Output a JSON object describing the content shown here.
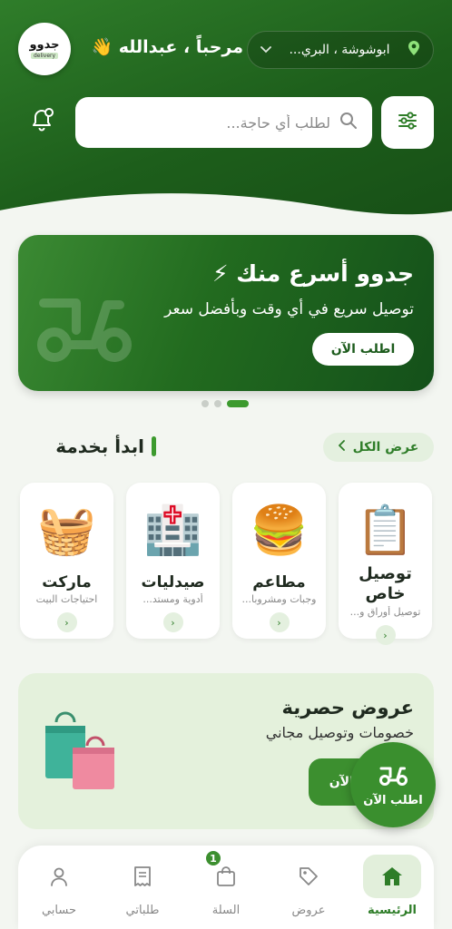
{
  "header": {
    "logo_text": "جدوو",
    "logo_sub": "delivery",
    "greeting": "مرحباً ، عبدالله 👋",
    "location": "ابوشوشة ، البري...",
    "search_placeholder": "لطلب أي حاجة..."
  },
  "banner": {
    "title": "جدوو أسرع منك ⚡",
    "subtitle": "توصيل سريع في أي وقت وبأفضل سعر",
    "button": "اطلب الآن",
    "slides": 3,
    "active_slide": 3
  },
  "services": {
    "title": "ابدأ بخدمة",
    "view_all": "عرض الكل",
    "items": [
      {
        "name": "توصيل خاص",
        "desc": "توصيل أوراق و...",
        "icon": "📋"
      },
      {
        "name": "مطاعم",
        "desc": "وجبات ومشروبا...",
        "icon": "🍔"
      },
      {
        "name": "صيدليات",
        "desc": "أدوية ومستد...",
        "icon": "🏥"
      },
      {
        "name": "ماركت",
        "desc": "احتياجات البيت",
        "icon": "🧺"
      }
    ]
  },
  "offers": {
    "title": "عروض حصرية",
    "subtitle": "خصومات وتوصيل مجاني",
    "button": "اطلب الآن"
  },
  "fab": {
    "label": "اطلب الآن"
  },
  "nav": {
    "items": [
      {
        "label": "الرئيسية",
        "icon": "home-icon",
        "active": true
      },
      {
        "label": "عروض",
        "icon": "tag-icon",
        "active": false
      },
      {
        "label": "السلة",
        "icon": "bag-icon",
        "active": false
      },
      {
        "label": "طلباتي",
        "icon": "receipt-icon",
        "active": false
      },
      {
        "label": "حسابي",
        "icon": "user-icon",
        "active": false
      }
    ],
    "cart_badge": "1"
  },
  "colors": {
    "primary": "#2e7d28",
    "primary_dark": "#174f16",
    "accent_light": "#e4f0df"
  }
}
